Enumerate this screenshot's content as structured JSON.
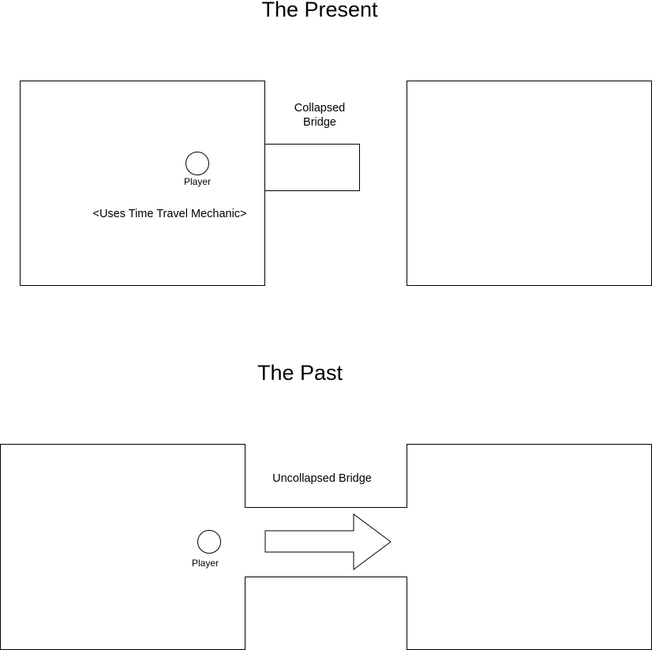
{
  "present": {
    "title": "The Present",
    "bridge_label_line1": "Collapsed",
    "bridge_label_line2": "Bridge",
    "player_label": "Player",
    "mechanic_label": "<Uses Time Travel Mechanic>"
  },
  "past": {
    "title": "The Past",
    "bridge_label": "Uncollapsed Bridge",
    "player_label": "Player"
  }
}
